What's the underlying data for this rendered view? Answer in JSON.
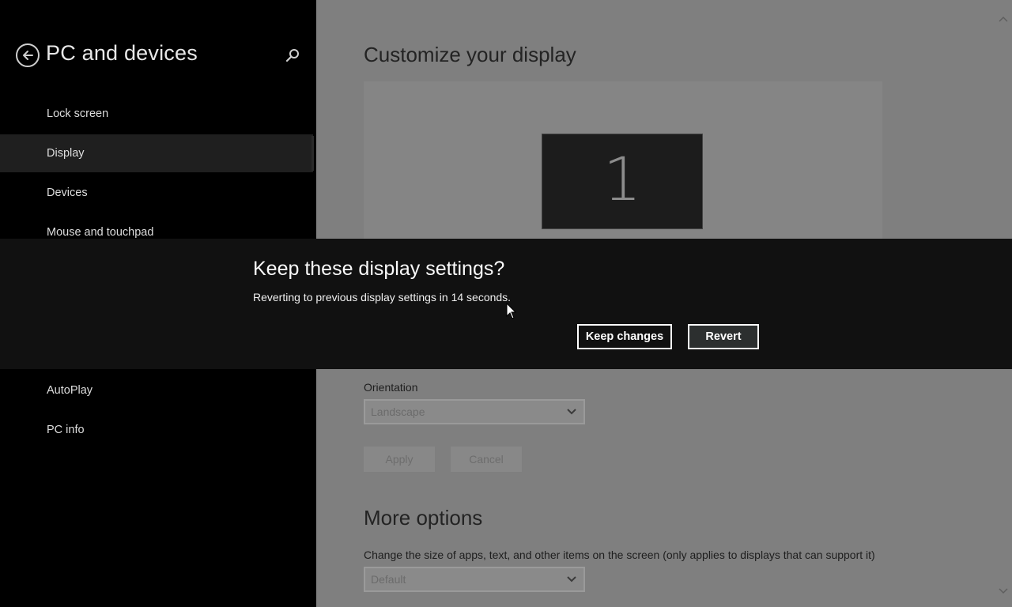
{
  "sidebar": {
    "title": "PC and devices",
    "back_icon": "back-arrow-circle-icon",
    "search_icon": "search-icon",
    "items": [
      {
        "label": "Lock screen",
        "selected": false
      },
      {
        "label": "Display",
        "selected": true
      },
      {
        "label": "Devices",
        "selected": false
      },
      {
        "label": "Mouse and touchpad",
        "selected": false
      },
      {
        "label": "AutoPlay",
        "selected": false
      },
      {
        "label": "PC info",
        "selected": false
      }
    ]
  },
  "main": {
    "title": "Customize your display",
    "monitor_number": "1",
    "orientation": {
      "label": "Orientation",
      "value": "Landscape"
    },
    "apply_label": "Apply",
    "cancel_label": "Cancel",
    "more_options": {
      "title": "More options",
      "size_label": "Change the size of apps, text, and other items on the screen (only applies to displays that can support it)",
      "size_value": "Default"
    }
  },
  "dialog": {
    "title": "Keep these display settings?",
    "message": "Reverting to previous display settings in 14 seconds.",
    "keep_label": "Keep changes",
    "revert_label": "Revert"
  },
  "colors": {
    "dialog_bg": "#111111",
    "sidebar_bg": "#000000",
    "main_bg_dimmed": "#7f7f7f",
    "selected_item_bg": "#1f1f1f"
  }
}
